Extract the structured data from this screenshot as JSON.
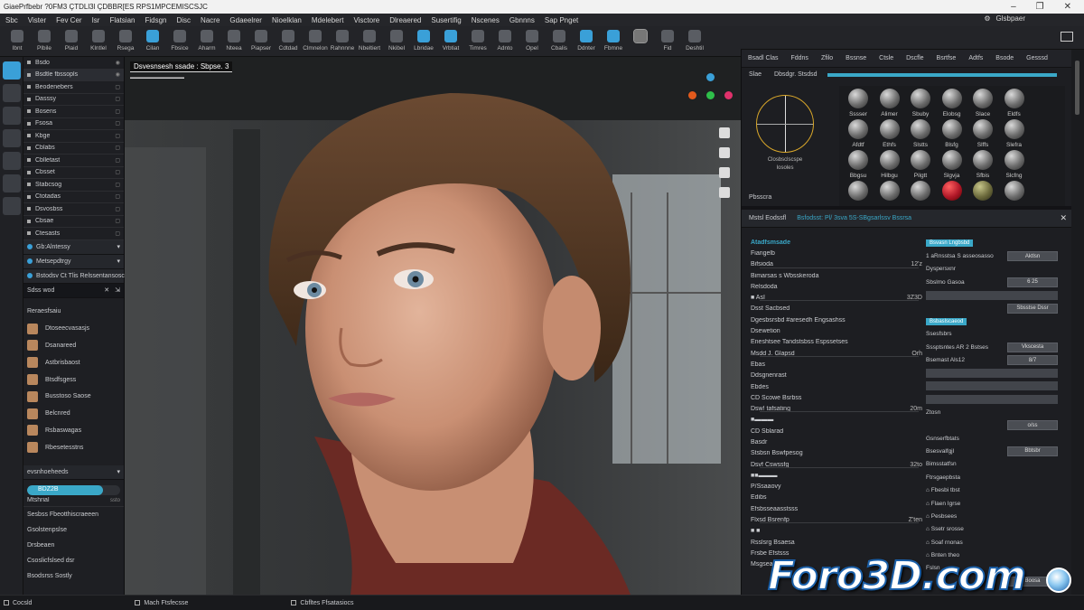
{
  "window": {
    "title": "GiaePrfbebr ?0FM3 ÇTDLl3l ÇDBBR[ES RPS1MPCEMISCSJC"
  },
  "menubar": {
    "items": [
      "Sbc",
      "Vister",
      "Fev Cer",
      "Isr",
      "Flatsian",
      "Fidsgn",
      "Disc",
      "Nacre",
      "Gdaeelrer",
      "Nioelklan",
      "Mdelebert",
      "Visctore",
      "Dlreaered",
      "Susertifig",
      "Nscenes",
      "Gbnnns",
      "Sap Pnget"
    ],
    "right": "Glsbpaer"
  },
  "toolbar": {
    "tools": [
      "Ibnt",
      "Plbile",
      "Plaid",
      "Klntlel",
      "Rsega",
      "Cilan",
      "Fbsice",
      "Aharm",
      "Nteea",
      "Piapser",
      "Cdtdad",
      "Clmnelon",
      "Rahnnne",
      "Nbeltiert",
      "Nkibel",
      "Lbridae",
      "Vrbtiat",
      "Timres",
      "Adnto",
      "Opel",
      "Cbalis",
      "Ddnter",
      "Fbmne",
      "",
      "Fid",
      "Deshtil"
    ]
  },
  "iconcol": {
    "icons": [
      "person-icon",
      "layers-icon",
      "brush-icon",
      "cloud-icon",
      "camera-icon",
      "render-icon",
      "list-icon"
    ]
  },
  "outliner": {
    "header_items": [
      {
        "label": "Bsdo",
        "r": "◉"
      },
      {
        "label": "Bsdtle fbssopls",
        "r": "◉"
      }
    ],
    "items": [
      {
        "label": "Beodenebers",
        "r": "▢"
      },
      {
        "label": "Dasssy",
        "r": "▢"
      },
      {
        "label": "Bosens",
        "r": "▢"
      },
      {
        "label": "Fsosa",
        "r": "▢"
      },
      {
        "label": "Kbge",
        "r": "▢"
      },
      {
        "label": "Cblabs",
        "r": "▢"
      },
      {
        "label": "Cblletast",
        "r": "▢"
      },
      {
        "label": "Cbsset",
        "r": "▢"
      },
      {
        "label": "Stabcsog",
        "r": "▢"
      },
      {
        "label": "Ctotadas",
        "r": "▢"
      },
      {
        "label": "Dsvosbss",
        "r": "▢"
      },
      {
        "label": "Cbsae",
        "r": "▢"
      },
      {
        "label": "Ctesasts",
        "r": "▢"
      }
    ],
    "sections": [
      {
        "label": "Gb:Alntessy",
        "r": "▾"
      },
      {
        "label": "Metsepdtrgy",
        "r": "▾"
      },
      {
        "label": "Bstodsv Ct Tlis Relssentansoscl",
        "r": ""
      }
    ],
    "search": {
      "label": "Sdss wod",
      "x": "✕",
      "pin": "⇲"
    },
    "assets_title": "Reraesfsaiu",
    "assets": [
      "Dtoseecvasasjs",
      "Dsanareed",
      "Astbrisbaost",
      "Btsdfsgess",
      "Busstoso Saose",
      "Belcnred",
      "Rsbaswagas",
      "Rbesetesstns"
    ],
    "subsect": "evsnhoeheeds",
    "progress_label": "BDZ2B",
    "progress_pct": 0.82,
    "mat_row": {
      "label": "Mtshrial",
      "v": "ssto"
    },
    "bottom": [
      "Sesbss Fbeotthiscraeeen",
      "Gsolstenpslse",
      "Drsbeaen",
      "Csoslicfslsed dsr",
      "Bsodsrss Sostly"
    ]
  },
  "viewport": {
    "label": "Dsvesnsesh ssade : Sbpse. 3",
    "sublabel": "▬▬▬▬▬▬▬▬▬▬▬▬",
    "dots": [
      "#3aa0d8",
      "#e25a1c",
      "#2fbf4a",
      "#e0316b"
    ]
  },
  "rightpanel": {
    "tabs": [
      "Bsadl Clas",
      "Fddns",
      "Zfilo",
      "Bssnse",
      "Ctsle",
      "Dscfle",
      "Bsrtfse",
      "Adtfs",
      "Bsode",
      "Gesssd"
    ],
    "mat_head": [
      "Slae",
      "Dbsdgr. Stsdsd"
    ],
    "gizmo_caption": [
      "Closbsclscspe",
      "Iosoles"
    ],
    "spheres": [
      {
        "label": "Sssser",
        "kind": ""
      },
      {
        "label": "Alimer",
        "kind": ""
      },
      {
        "label": "Sbuby",
        "kind": ""
      },
      {
        "label": "Elobsg",
        "kind": ""
      },
      {
        "label": "Slace",
        "kind": ""
      },
      {
        "label": "Eldfs",
        "kind": ""
      },
      {
        "label": "Afdtf",
        "kind": ""
      },
      {
        "label": "Ethfs",
        "kind": ""
      },
      {
        "label": "Slstts",
        "kind": ""
      },
      {
        "label": "Blsfg",
        "kind": ""
      },
      {
        "label": "Slffs",
        "kind": ""
      },
      {
        "label": "Slefra",
        "kind": ""
      },
      {
        "label": "Bbgsu",
        "kind": ""
      },
      {
        "label": "Hilbgu",
        "kind": ""
      },
      {
        "label": "Pilgtt",
        "kind": ""
      },
      {
        "label": "Slgvja",
        "kind": ""
      },
      {
        "label": "Sfbis",
        "kind": ""
      },
      {
        "label": "Slcfng",
        "kind": ""
      },
      {
        "label": "",
        "kind": ""
      },
      {
        "label": "",
        "kind": ""
      },
      {
        "label": "",
        "kind": ""
      },
      {
        "label": "",
        "kind": "red"
      },
      {
        "label": "",
        "kind": "ol"
      },
      {
        "label": "",
        "kind": ""
      }
    ],
    "mat_footer": "Pbsscra",
    "attr_tab1": "Mstsl Eodssfl",
    "attr_tab2": "Bsfodsst: Pl/ 3sva 5S-SBgsarlssv Bssrsa",
    "attrs_left": [
      {
        "k": "Atadfsmsade",
        "v": "",
        "h": true
      },
      {
        "k": "Fiangelb",
        "v": ""
      },
      {
        "k": "Bifsioda",
        "v": "12'z"
      },
      {
        "k": "Bimarsas s Wbsskeroda",
        "v": ""
      },
      {
        "k": "Relsdoda",
        "v": ""
      },
      {
        "k": "■  AsI",
        "v": "3Z3D"
      },
      {
        "k": "Dsst Sacbsed",
        "v": ""
      },
      {
        "k": "Dgesbsrsbd #aresedh Engsashss",
        "v": ""
      },
      {
        "k": "Dsewetion",
        "v": ""
      },
      {
        "k": "Eneshtsee Tandstsbss Espssetses",
        "v": ""
      },
      {
        "k": "Msdd J. Glapsd",
        "v": "Orh"
      },
      {
        "k": "Ebas",
        "v": ""
      },
      {
        "k": "Ddsgnenrast",
        "v": ""
      },
      {
        "k": "Ebdes",
        "v": ""
      },
      {
        "k": "CD Scowe Bsrbss",
        "v": ""
      },
      {
        "k": "Dsw! tafsating",
        "v": "20m"
      },
      {
        "k": "■▬▬▬",
        "v": ""
      },
      {
        "k": "CD Sblarad",
        "v": ""
      },
      {
        "k": "Basdr",
        "v": ""
      },
      {
        "k": "Stsbsn Bswfpesog",
        "v": ""
      },
      {
        "k": "Dsvf Cswssfg",
        "v": "32to"
      },
      {
        "k": "■■▬▬▬",
        "v": ""
      },
      {
        "k": "P/Ssaaovy",
        "v": ""
      },
      {
        "k": "Edibs",
        "v": ""
      },
      {
        "k": "Efsbsseaasstsss",
        "v": ""
      },
      {
        "k": "Flxsd Bsrenfp",
        "v": "Z'ten"
      },
      {
        "k": "■ ■",
        "v": ""
      },
      {
        "k": "Rsslsrg Bsaesa",
        "v": ""
      },
      {
        "k": "Frsbe Efstsss",
        "v": ""
      },
      {
        "k": "Msgsea",
        "v": ""
      }
    ],
    "attrs_right": [
      {
        "k": "",
        "btn": "Bsvasn Lngbsbd",
        "fld": ""
      },
      {
        "k": "1 aRnsstsa S asseosasso",
        "btn": "",
        "fld": "Aktlsn"
      },
      {
        "k": "Dyspersxnr",
        "btn": "",
        "fld": ""
      },
      {
        "k": "Sbslmo Gasoa",
        "btn": "",
        "fld": "6 25"
      },
      {
        "k": "",
        "btn": "",
        "fld": ""
      },
      {
        "k": "",
        "btn": "",
        "fld": "Sbsstse Dssr"
      },
      {
        "k": "",
        "btn": "Bsbaslscaeod",
        "fld": ""
      },
      {
        "k": "Ssesfsbrs",
        "btn": "",
        "fld": ""
      },
      {
        "k": "Sssptsntes AR 2 Bstses",
        "btn": "",
        "fld": "Vkscesta"
      },
      {
        "k": "Bsemast Als12",
        "btn": "",
        "fld": "8/7"
      },
      {
        "k": "",
        "btn": "",
        "fld": ""
      },
      {
        "k": "",
        "btn": "",
        "fld": ""
      },
      {
        "k": "",
        "btn": "",
        "fld": ""
      },
      {
        "k": "Ztosn",
        "btn": "",
        "fld": ""
      },
      {
        "k": "",
        "btn": "",
        "fld": "o/ss"
      },
      {
        "k": "Gsnserfbtats",
        "btn": "",
        "fld": ""
      },
      {
        "k": "Bsesvalfgjl",
        "btn": "",
        "fld": "Bbtsbr"
      },
      {
        "k": "Bimsstatfsn",
        "btn": "",
        "fld": ""
      },
      {
        "k": "Ftrsgaepbsta",
        "btn": "",
        "fld": ""
      },
      {
        "k": "⌂ Fbesbi tbst",
        "btn": "",
        "fld": ""
      },
      {
        "k": "⌂ Flaen Igrse",
        "btn": "",
        "fld": ""
      },
      {
        "k": "⌂ Pesbsees",
        "btn": "",
        "fld": ""
      },
      {
        "k": "⌂ Ssetr srosse",
        "btn": "",
        "fld": ""
      },
      {
        "k": "⌂ Soaf rnonas",
        "btn": "",
        "fld": ""
      },
      {
        "k": "⌂ Bnten theo",
        "btn": "",
        "fld": ""
      },
      {
        "k": "Fslsn",
        "btn": "",
        "fld": ""
      },
      {
        "k": "",
        "btn": "",
        "fld": "Boosa"
      }
    ]
  },
  "statusbar": {
    "items": [
      "Cocsld",
      "Mach Ftsfecsse",
      "Cbfltes Ffsatasiocs"
    ]
  },
  "watermark": {
    "text": "Foro3D.com"
  }
}
